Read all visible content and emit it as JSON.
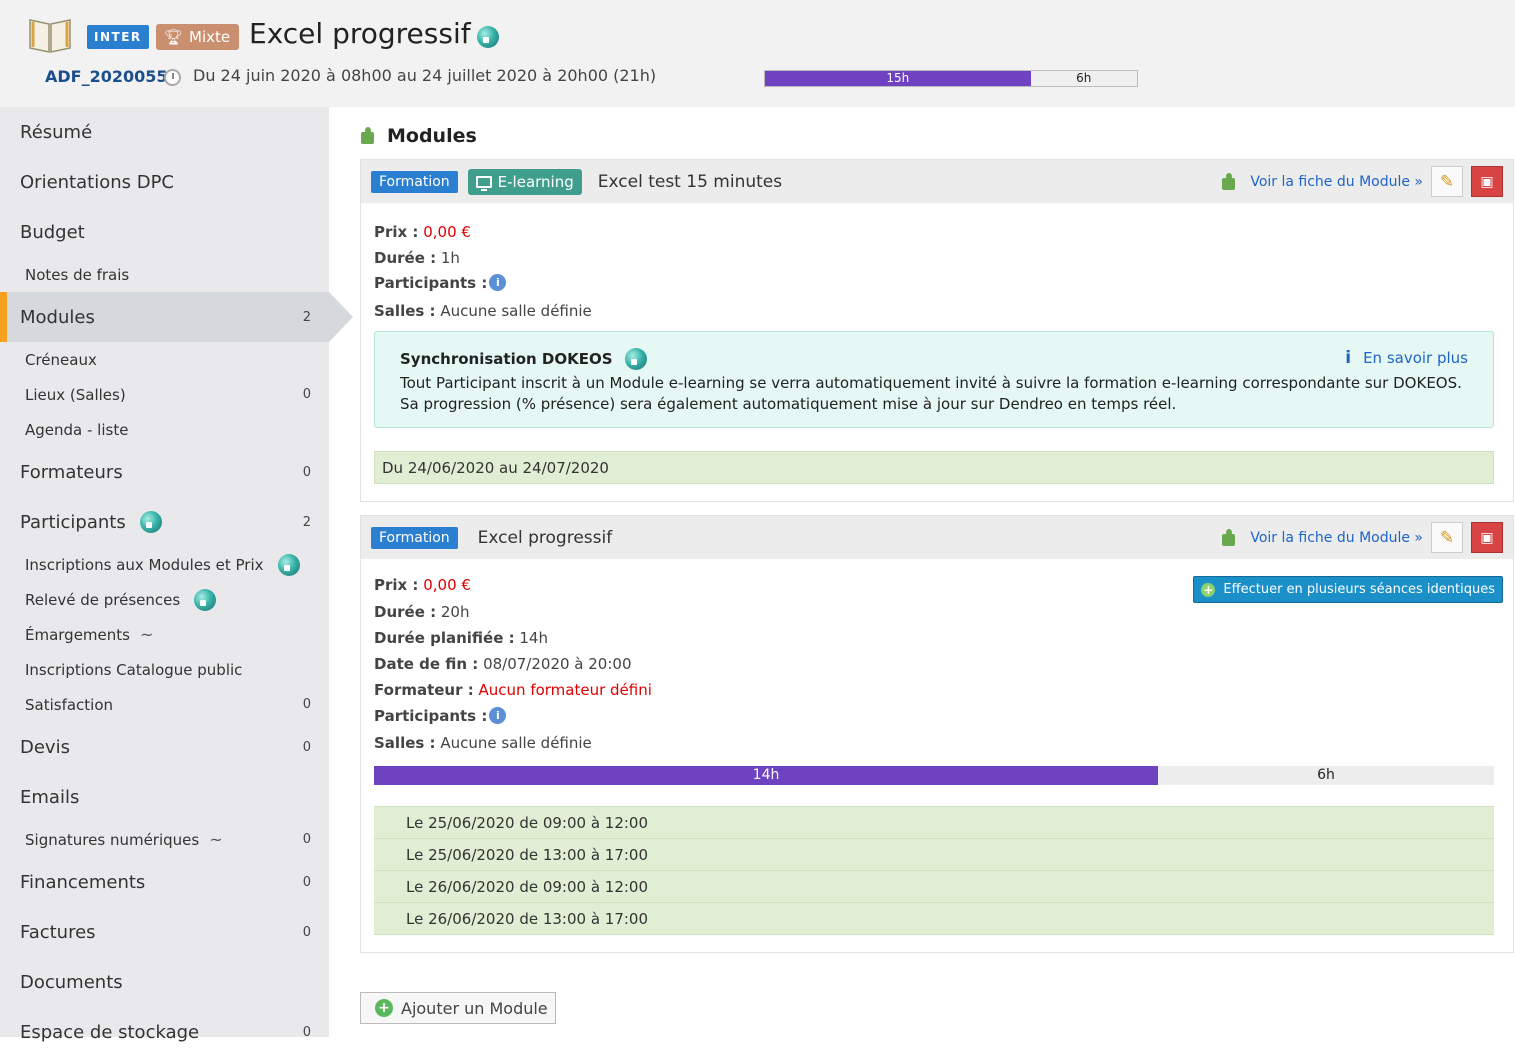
{
  "header": {
    "badge_inter": "INTER",
    "badge_mixte": "Mixte",
    "title": "Excel progressif",
    "reference": "ADF_2020055",
    "dates": "Du 24 juin 2020 à 08h00 au 24 juillet 2020 à 20h00 (21h)",
    "progress": {
      "done_label": "15h",
      "rest_label": "6h",
      "done_fraction": 0.714
    }
  },
  "sidebar": {
    "items": [
      {
        "label": "Résumé"
      },
      {
        "label": "Orientations DPC"
      },
      {
        "label": "Budget"
      },
      {
        "label": "Notes de frais"
      },
      {
        "label": "Modules",
        "count": "2"
      },
      {
        "label": "Créneaux"
      },
      {
        "label": "Lieux (Salles)",
        "count": "0"
      },
      {
        "label": "Agenda - liste"
      },
      {
        "label": "Formateurs",
        "count": "0"
      },
      {
        "label": "Participants",
        "count": "2"
      },
      {
        "label": "Inscriptions aux Modules et Prix"
      },
      {
        "label": "Relevé de présences"
      },
      {
        "label": "Émargements"
      },
      {
        "label": "Inscriptions Catalogue public"
      },
      {
        "label": "Satisfaction",
        "count": "0"
      },
      {
        "label": "Devis",
        "count": "0"
      },
      {
        "label": "Emails"
      },
      {
        "label": "Signatures numériques",
        "count": "0"
      },
      {
        "label": "Financements",
        "count": "0"
      },
      {
        "label": "Factures",
        "count": "0"
      },
      {
        "label": "Documents"
      },
      {
        "label": "Espace de stockage",
        "count": "0"
      }
    ]
  },
  "main": {
    "section_title": "Modules",
    "module1": {
      "tag": "Formation",
      "elearning_tag": "E-learning",
      "name": "Excel test 15 minutes",
      "voir_link": "Voir la fiche du Module »",
      "prix_label": "Prix :",
      "prix_value": "0,00 €",
      "duree_label": "Durée :",
      "duree_value": "1h",
      "participants_label": "Participants :",
      "salles_label": "Salles :",
      "salles_value": "Aucune salle définie",
      "sync": {
        "title": "Synchronisation DOKEOS",
        "more": "En savoir plus",
        "line1": "Tout Participant inscrit à un Module e-learning se verra automatiquement invité à suivre la formation e-learning correspondante sur DOKEOS.",
        "line2": "Sa progression (% présence) sera également automatiquement mise à jour sur Dendreo en temps réel."
      },
      "date_range": "Du 24/06/2020 au 24/07/2020"
    },
    "module2": {
      "tag": "Formation",
      "name": "Excel progressif",
      "voir_link": "Voir la fiche du Module »",
      "multi_button": "Effectuer en plusieurs séances identiques",
      "prix_label": "Prix :",
      "prix_value": "0,00 €",
      "duree_label": "Durée :",
      "duree_value": "20h",
      "duree_planifiee_label": "Durée planifiée :",
      "duree_planifiee_value": "14h",
      "date_fin_label": "Date de fin :",
      "date_fin_value": "08/07/2020 à 20:00",
      "formateur_label": "Formateur :",
      "formateur_value": "Aucun formateur défini",
      "participants_label": "Participants :",
      "salles_label": "Salles :",
      "salles_value": "Aucune salle définie",
      "progress": {
        "done_label": "14h",
        "rest_label": "6h",
        "done_fraction": 0.7
      },
      "slots": [
        "Le 25/06/2020 de 09:00 à 12:00",
        "Le 25/06/2020 de 13:00 à 17:00",
        "Le 26/06/2020 de 09:00 à 12:00",
        "Le 26/06/2020 de 13:00 à 17:00"
      ]
    },
    "add_button": "Ajouter un Module"
  },
  "colors": {
    "accent_purple": "#6f42c1",
    "active_marker": "#f5a020",
    "link": "#1d64c8",
    "error": "#e00000"
  }
}
